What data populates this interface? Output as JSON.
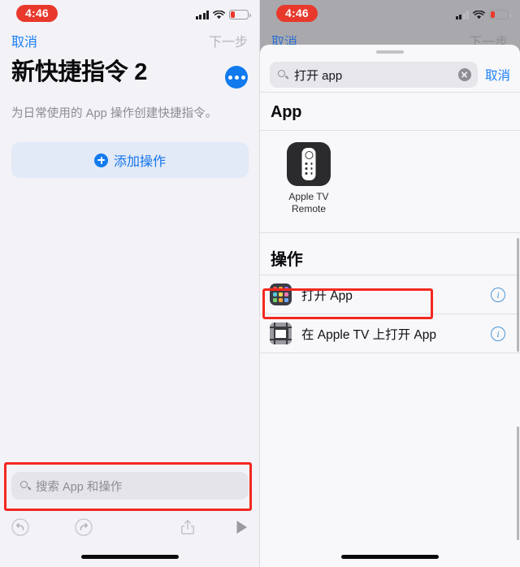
{
  "left_panel": {
    "status_bar": {
      "time": "4:46",
      "signal_icon": "cellular-bars-icon",
      "wifi_icon": "wifi-icon",
      "battery_icon": "battery-low-icon"
    },
    "nav": {
      "cancel_label": "取消",
      "next_label": "下一步"
    },
    "title": "新快捷指令 2",
    "more_button_icon": "ellipsis-icon",
    "subtitle": "为日常使用的 App 操作创建快捷指令。",
    "add_action": {
      "label": "添加操作",
      "icon": "plus-circle-icon"
    },
    "bottom_search": {
      "placeholder": "搜索 App 和操作",
      "icon": "search-icon"
    },
    "toolbar": {
      "undo_icon": "undo-icon",
      "redo_icon": "redo-icon",
      "share_icon": "share-icon",
      "play_icon": "play-icon"
    },
    "annotation_color": "#f3281f"
  },
  "right_panel": {
    "status_bar": {
      "time": "4:46",
      "signal_icon": "cellular-bars-icon",
      "wifi_icon": "wifi-icon",
      "battery_icon": "battery-low-icon"
    },
    "background_nav": {
      "cancel_label": "取消",
      "next_label": "下一步"
    },
    "sheet": {
      "grabber_icon": "sheet-grabber",
      "search": {
        "icon": "search-icon",
        "value": "打开 app",
        "clear_icon": "clear-circle-icon",
        "cancel_label": "取消"
      },
      "app_section": {
        "header": "App",
        "apps": [
          {
            "name": "Apple TV\nRemote",
            "name_line1": "Apple TV",
            "name_line2": "Remote",
            "icon": "apple-tv-remote-icon"
          }
        ]
      },
      "actions_section": {
        "header": "操作",
        "rows": [
          {
            "label": "打开 App",
            "icon": "app-grid-icon",
            "info_icon": "info-circle-icon",
            "highlighted": true
          },
          {
            "label": "在 Apple TV 上打开 App",
            "icon": "apple-tv-icon",
            "info_icon": "info-circle-icon",
            "highlighted": false
          }
        ]
      }
    },
    "annotation_color": "#f3281f"
  },
  "grid_icon_colors": [
    "#f05c4a",
    "#f0a23c",
    "#9b6ee0",
    "#57c8d8",
    "#f5d94a",
    "#f07ab0",
    "#6fd06a",
    "#f0a23c",
    "#6aa9f0"
  ]
}
